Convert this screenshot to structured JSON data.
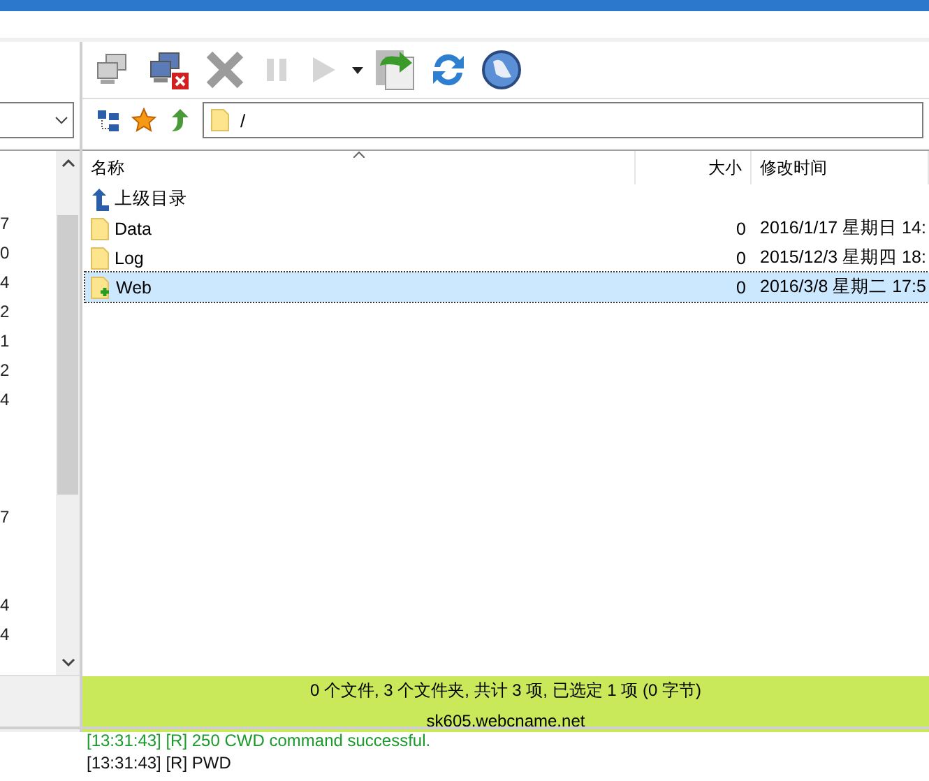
{
  "toolbar": {
    "buttons": [
      {
        "kind": "connect",
        "disabled": true
      },
      {
        "kind": "disconnect"
      },
      {
        "kind": "stop",
        "disabled": true
      },
      {
        "kind": "pause",
        "disabled": true
      },
      {
        "kind": "play",
        "disabled": true
      },
      {
        "kind": "dropdown"
      },
      {
        "kind": "transfer"
      },
      {
        "kind": "refresh"
      },
      {
        "kind": "web"
      }
    ]
  },
  "address": {
    "path": "/"
  },
  "local_list": {
    "sizes": [
      "7",
      "0",
      "4",
      "2",
      "1",
      "2",
      "4",
      "7",
      "4",
      "4"
    ]
  },
  "table": {
    "columns": [
      "名称",
      "大小",
      "修改时间"
    ],
    "rows": [
      {
        "kind": "parent",
        "name": "上级目录",
        "selected": false
      },
      {
        "kind": "folder",
        "name": "Data",
        "size": "0",
        "modified": "2016/1/17 星期日 14:",
        "selected": false
      },
      {
        "kind": "folder",
        "name": "Log",
        "size": "0",
        "modified": "2015/12/3 星期四 18:",
        "selected": false
      },
      {
        "kind": "newfolder",
        "name": "Web",
        "size": "0",
        "modified": "2016/3/8 星期二 17:5",
        "selected": true
      }
    ]
  },
  "status_bar": {
    "summary": "0 个文件, 3 个文件夹, 共计 3 项, 已选定 1 项 (0 字节)",
    "server": "sk605.webcname.net"
  },
  "log": [
    {
      "kind": "success",
      "text": "[13:31:43]  [R] 250 CWD command successful."
    },
    {
      "kind": "info",
      "text": "[13:31:43]  [R] PWD"
    }
  ]
}
